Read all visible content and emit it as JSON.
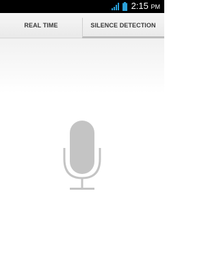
{
  "status_bar": {
    "time": "2:15",
    "time_suffix": "PM",
    "icons": [
      "signal-icon",
      "battery-icon"
    ]
  },
  "tabs": [
    {
      "label": "REAL TIME",
      "selected": false
    },
    {
      "label": "SILENCE DETECTION",
      "selected": true
    }
  ],
  "main": {
    "microphone_icon": "microphone-icon"
  },
  "colors": {
    "status_bar_bg": "#000000",
    "status_icon": "#2aa0d8",
    "tab_text": "#3a3a3a",
    "tab_indicator": "#bdbdbd",
    "mic_gray": "#c4c4c4"
  }
}
